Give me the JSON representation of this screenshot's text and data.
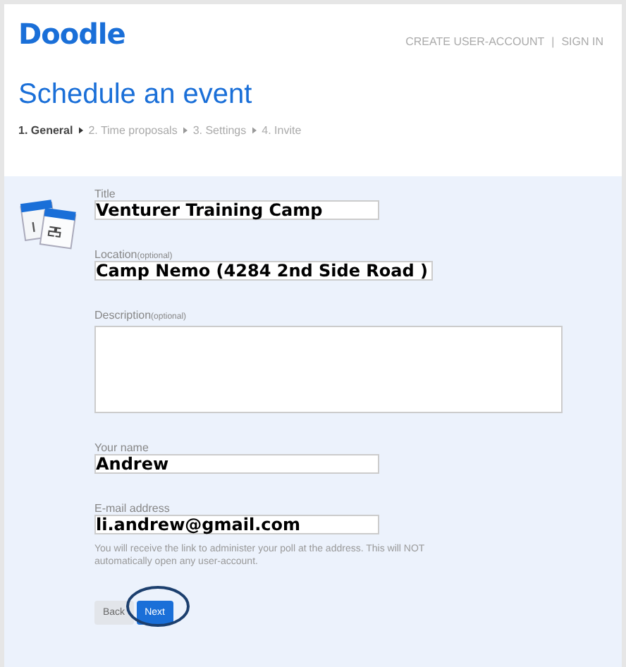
{
  "header": {
    "logo": "Doodle",
    "links": [
      {
        "label": "CREATE USER-ACCOUNT"
      },
      {
        "label": "SIGN IN"
      }
    ],
    "separator": "|"
  },
  "page_title": "Schedule an event",
  "steps": [
    {
      "label": "1. General",
      "selected": true
    },
    {
      "label": "2. Time proposals",
      "selected": false
    },
    {
      "label": "3. Settings",
      "selected": false
    },
    {
      "label": "4. Invite",
      "selected": false
    }
  ],
  "fields": [
    {
      "kind": "input",
      "label": "Title",
      "value": "Venturer Training Camp"
    },
    {
      "kind": "input",
      "label": "Location",
      "hint": "(optional)",
      "value": "Camp Nemo (4284 2nd Side Road )"
    },
    {
      "kind": "textarea",
      "label": "Description",
      "hint": "(optional)"
    },
    {
      "kind": "input",
      "label": "Your name",
      "value": "Andrew"
    },
    {
      "kind": "input",
      "label": "E-mail address",
      "value": "li.andrew@gmail.com",
      "note": "You will receive the link to administer your poll at the address. This will NOT automatically open any user-account."
    }
  ],
  "buttons": [
    {
      "label": "Back",
      "disabled": true,
      "highlighted": false
    },
    {
      "label": "Next",
      "disabled": false,
      "highlighted": true
    }
  ]
}
